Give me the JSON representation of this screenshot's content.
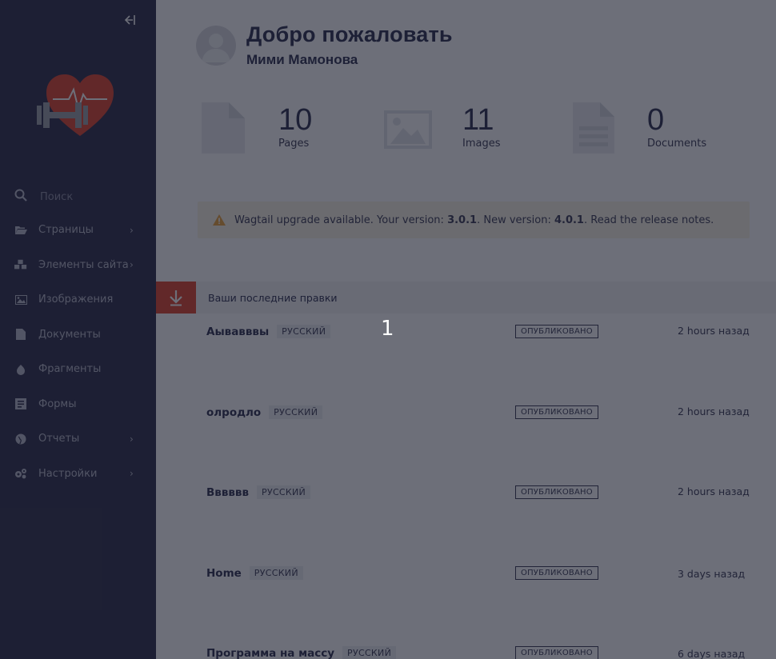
{
  "sidebar": {
    "collapse_icon": "collapse-left-icon",
    "search": {
      "placeholder": "Поиск"
    },
    "menu": [
      {
        "label": "Страницы",
        "icon": "folder-open-icon",
        "has_submenu": true
      },
      {
        "label": "Элементы сайта",
        "icon": "cubes-icon",
        "has_submenu": true
      },
      {
        "label": "Изображения",
        "icon": "image-icon",
        "has_submenu": false
      },
      {
        "label": "Документы",
        "icon": "document-icon",
        "has_submenu": false
      },
      {
        "label": "Фрагменты",
        "icon": "snippet-icon",
        "has_submenu": false
      },
      {
        "label": "Формы",
        "icon": "form-icon",
        "has_submenu": false
      },
      {
        "label": "Отчеты",
        "icon": "globe-icon",
        "has_submenu": true
      },
      {
        "label": "Настройки",
        "icon": "cogs-icon",
        "has_submenu": true
      }
    ]
  },
  "header": {
    "welcome": "Добро пожаловать",
    "username": "Мими Мамонова"
  },
  "stats": [
    {
      "count": "10",
      "label": "Pages",
      "icon": "page-icon"
    },
    {
      "count": "11",
      "label": "Images",
      "icon": "image-icon"
    },
    {
      "count": "0",
      "label": "Documents",
      "icon": "document-icon"
    }
  ],
  "upgrade": {
    "text_before": "Wagtail upgrade available. Your version: ",
    "current_version": "3.0.1",
    "text_middle": ". New version: ",
    "new_version": "4.0.1",
    "text_after": ". Read the release notes."
  },
  "edits": {
    "title": "Ваши последние правки",
    "rows": [
      {
        "title": "Аывавввы",
        "lang": "РУССКИЙ",
        "status": "ОПУБЛИКОВАНО",
        "time": "2 hours назад"
      },
      {
        "title": "олродло",
        "lang": "РУССКИЙ",
        "status": "ОПУБЛИКОВАНО",
        "time": "2 hours назад"
      },
      {
        "title": "Вввввв",
        "lang": "РУССКИЙ",
        "status": "ОПУБЛИКОВАНО",
        "time": "2 hours назад"
      },
      {
        "title": "Home",
        "lang": "РУССКИЙ",
        "status": "ОПУБЛИКОВАНО",
        "time": "3 days назад"
      },
      {
        "title": "Программа на массу",
        "lang": "РУССКИЙ",
        "status": "ОПУБЛИКОВАНО",
        "time": "6 days назад"
      }
    ]
  },
  "overlay": {
    "step_number": "1"
  },
  "colors": {
    "sidebar_bg": "#2e2f4a",
    "accent": "#e3452f",
    "text_dark": "#2e3050",
    "warning_bg": "#faf4e4"
  }
}
